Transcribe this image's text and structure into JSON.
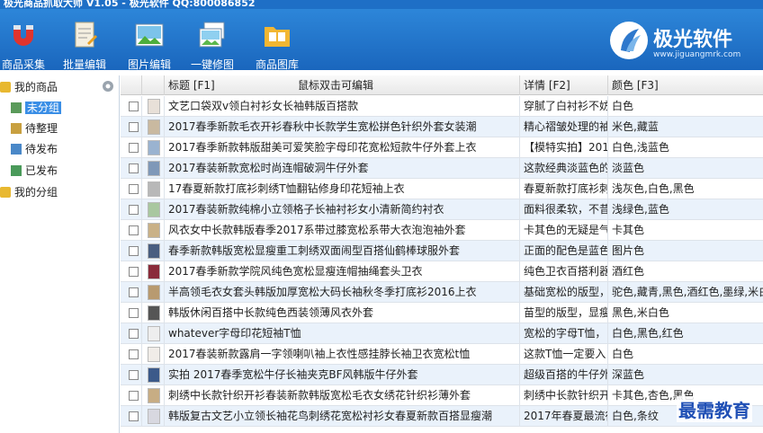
{
  "window": {
    "title": "极光商品抓取大师 V1.05 - 极光软件 QQ:800086852"
  },
  "toolbar": {
    "buttons": [
      {
        "label": "商品采集",
        "icon": "magnet-icon"
      },
      {
        "label": "批量编辑",
        "icon": "document-edit-icon"
      },
      {
        "label": "图片编辑",
        "icon": "image-edit-icon"
      },
      {
        "label": "一键修图",
        "icon": "photo-fix-icon"
      },
      {
        "label": "商品图库",
        "icon": "gallery-folder-icon"
      }
    ]
  },
  "logo": {
    "brand": "极光软件",
    "url": "www.jiguangmrk.com"
  },
  "tree": {
    "root": "我的商品",
    "items": [
      "未分组",
      "待整理",
      "待发布",
      "已发布"
    ],
    "root2": "我的分组"
  },
  "grid": {
    "headers": {
      "title": "标题 [F1]",
      "hint": "鼠标双击可编辑",
      "detail": "详情 [F2]",
      "color": "颜色 [F3]"
    },
    "rows": [
      {
        "title": "文艺口袋双v领白衬衫女长袖韩版百搭款",
        "detail": "穿腻了白衬衫不妨",
        "color": "白色",
        "thumb": "#e8e0d8"
      },
      {
        "title": "2017春季新款毛衣开衫春秋中长款学生宽松拼色针织外套女装潮",
        "detail": "精心褶皱处理的袖",
        "color": "米色,藏蓝",
        "thumb": "#c9b9a0"
      },
      {
        "title": "2017春季新款韩版甜美可爱笑脸字母印花宽松短款牛仔外套上衣",
        "detail": "【模特实拍】201",
        "color": "白色,浅蓝色",
        "thumb": "#9ab3d0"
      },
      {
        "title": "2017春装新款宽松时尚连帽破洞牛仔外套",
        "detail": "这款经典淡蓝色的",
        "color": "淡蓝色",
        "thumb": "#7f98b8"
      },
      {
        "title": "17春夏新款打底衫刺绣T恤翻钻修身印花短袖上衣",
        "detail": "春夏新款打底衫刺",
        "color": "浅灰色,白色,黑色",
        "thumb": "#b8b8b8"
      },
      {
        "title": "2017春装新款纯棉小立领格子长袖衬衫女小清新简约衬衣",
        "detail": "面料很柔软，不昔",
        "color": "浅绿色,蓝色",
        "thumb": "#a9c7a0"
      },
      {
        "title": "风衣女中长款韩版春季2017系带过膝宽松系带大衣泡泡袖外套",
        "detail": "卡其色的无疑是气",
        "color": "卡其色",
        "thumb": "#c9b187"
      },
      {
        "title": "春季新款韩版宽松显瘦重工刺绣双面闹型百搭仙鹤棒球服外套",
        "detail": "正面的配色是蓝色",
        "color": "图片色",
        "thumb": "#4a5e80"
      },
      {
        "title": "2017春季新款学院风纯色宽松显瘦连帽抽绳套头卫衣",
        "detail": "纯色卫衣百搭利器",
        "color": "酒红色",
        "thumb": "#8a2b3a"
      },
      {
        "title": "半高领毛衣女套头韩版加厚宽松大码长袖秋冬季打底衫2016上衣",
        "detail": "基础宽松的版型，",
        "color": "驼色,藏青,黑色,酒红色,墨绿,米白",
        "thumb": "#b89a70"
      },
      {
        "title": "韩版休闲百搭中长款纯色西装领薄风衣外套",
        "detail": "苗型的版型，显瘦",
        "color": "黑色,米白色",
        "thumb": "#555555"
      },
      {
        "title": "whatever字母印花短袖T恤",
        "detail": "宽松的字母T恤，",
        "color": "白色,黑色,红色",
        "thumb": "#eeeeee"
      },
      {
        "title": "2017春装新款露肩一字领喇叭袖上衣性感挂脖长袖卫衣宽松t恤",
        "detail": "这款T恤一定要入",
        "color": "白色",
        "thumb": "#f0ece8"
      },
      {
        "title": "实拍 2017春季宽松牛仔长袖夹克BF风韩版牛仔外套",
        "detail": "超级百搭的牛仔外",
        "color": "深蓝色",
        "thumb": "#3c5a8a"
      },
      {
        "title": "刺绣中长款针织开衫春装新款韩版宽松毛衣女绣花针织衫薄外套",
        "detail": "刺绣中长款针织开",
        "color": "卡其色,杏色,黑色",
        "thumb": "#c7ad84"
      },
      {
        "title": "韩版复古文艺小立领长袖花鸟刺绣花宽松衬衫女春夏新款百搭显瘦潮",
        "detail": "2017年春夏最流行",
        "color": "白色,条纹",
        "thumb": "#d8d8e0"
      }
    ]
  },
  "watermark": "最需教育"
}
